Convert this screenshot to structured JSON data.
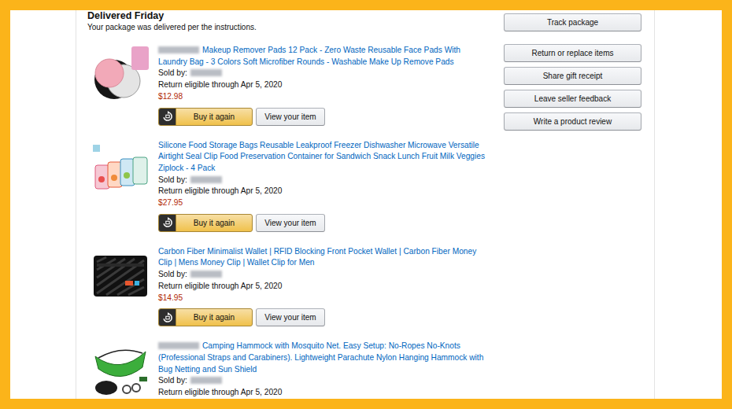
{
  "shipment": {
    "status": "Delivered Friday",
    "note": "Your package was delivered per the instructions."
  },
  "items": [
    {
      "brand_blurred": true,
      "title": "Makeup Remover Pads 12 Pack - Zero Waste Reusable Face Pads With Laundry Bag - 3 Colors Soft Microfiber Rounds - Washable Make Up Remove Pads",
      "sold_by_label": "Sold by:",
      "seller_blurred": true,
      "return_text": "Return eligible through Apr 5, 2020",
      "price": "$12.98",
      "buy_again": "Buy it again",
      "view_item": "View your item"
    },
    {
      "brand_blurred": false,
      "title": "Silicone Food Storage Bags Reusable Leakproof Freezer Dishwasher Microwave Versatile Airtight Seal Clip Food Preservation Container for Sandwich Snack Lunch Fruit Milk Veggies Ziplock - 4 Pack",
      "sold_by_label": "Sold by:",
      "seller_blurred": true,
      "return_text": "Return eligible through Apr 5, 2020",
      "price": "$27.95",
      "buy_again": "Buy it again",
      "view_item": "View your item"
    },
    {
      "brand_blurred": false,
      "title": "Carbon Fiber Minimalist Wallet | RFID Blocking Front Pocket Wallet | Carbon Fiber Money Clip | Mens Money Clip | Wallet Clip for Men",
      "sold_by_label": "Sold by:",
      "seller_blurred": true,
      "return_text": "Return eligible through Apr 5, 2020",
      "price": "$14.95",
      "buy_again": "Buy it again",
      "view_item": "View your item"
    },
    {
      "brand_blurred": true,
      "title": "Camping Hammock with Mosquito Net. Easy Setup: No-Ropes No-Knots (Professional Straps and Carabiners). Lightweight Parachute Nylon Hanging Hammock with Bug Netting and Sun Shield",
      "sold_by_label": "Sold by:",
      "seller_blurred": true,
      "return_text": "Return eligible through Apr 5, 2020"
    }
  ],
  "actions": [
    "Track package",
    "Return or replace items",
    "Share gift receipt",
    "Leave seller feedback",
    "Write a product review"
  ]
}
